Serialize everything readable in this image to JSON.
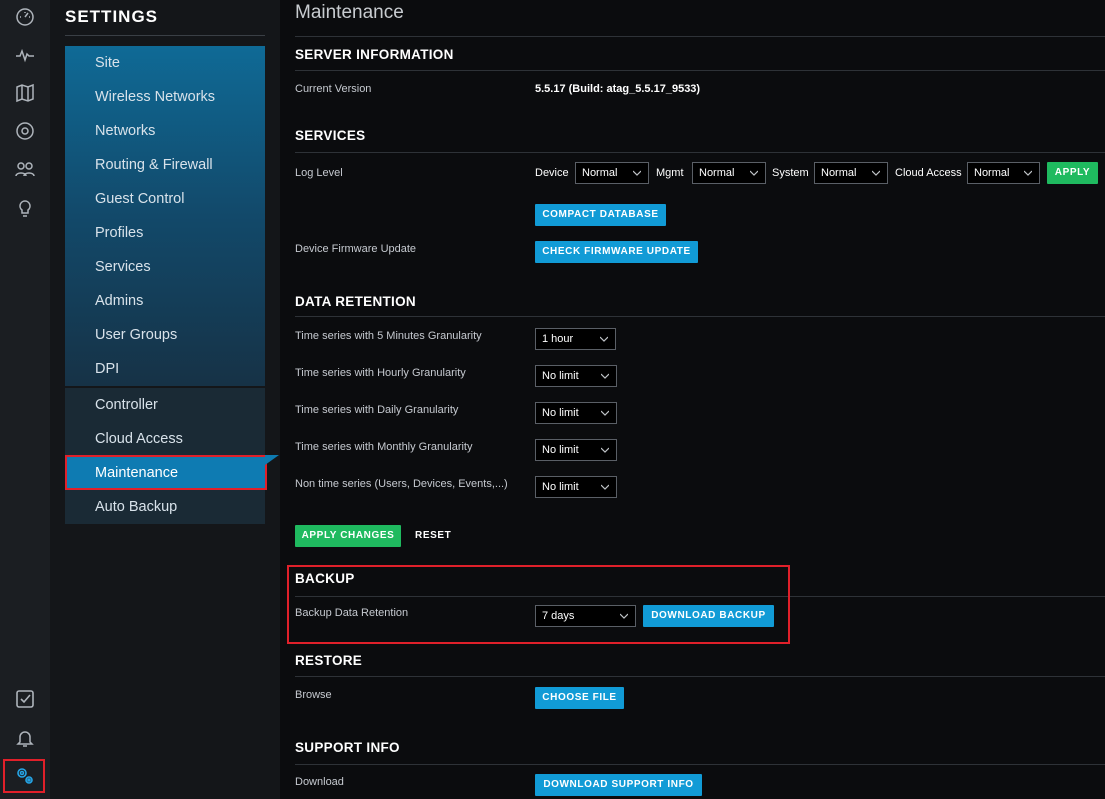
{
  "rail": {
    "icons": [
      "dashboard-icon",
      "statistics-icon",
      "map-icon",
      "devices-icon",
      "clients-icon",
      "insights-icon",
      "tasks-icon",
      "alerts-icon",
      "settings-icon"
    ]
  },
  "nav": {
    "title": "SETTINGS",
    "items": [
      {
        "label": "Site"
      },
      {
        "label": "Wireless Networks"
      },
      {
        "label": "Networks"
      },
      {
        "label": "Routing & Firewall"
      },
      {
        "label": "Guest Control"
      },
      {
        "label": "Profiles"
      },
      {
        "label": "Services"
      },
      {
        "label": "Admins"
      },
      {
        "label": "User Groups"
      },
      {
        "label": "DPI"
      },
      {
        "label": "Controller"
      },
      {
        "label": "Cloud Access"
      },
      {
        "label": "Maintenance"
      },
      {
        "label": "Auto Backup"
      }
    ],
    "active": "Maintenance"
  },
  "page": {
    "title": "Maintenance"
  },
  "server_info": {
    "title": "SERVER INFORMATION",
    "current_version_label": "Current Version",
    "current_version_value": "5.5.17 (Build: atag_5.5.17_9533)"
  },
  "services": {
    "title": "SERVICES",
    "log_level_label": "Log Level",
    "device_label": "Device",
    "device_value": "Normal",
    "mgmt_label": "Mgmt",
    "mgmt_value": "Normal",
    "system_label": "System",
    "system_value": "Normal",
    "cloud_access_label": "Cloud Access",
    "cloud_access_value": "Normal",
    "apply_label": "APPLY",
    "compact_db_label": "COMPACT DATABASE",
    "firmware_update_label": "Device Firmware Update",
    "check_firmware_label": "CHECK FIRMWARE UPDATE"
  },
  "data_retention": {
    "title": "DATA RETENTION",
    "rows": [
      {
        "label": "Time series with 5 Minutes Granularity",
        "value": "1 hour"
      },
      {
        "label": "Time series with Hourly Granularity",
        "value": "No limit"
      },
      {
        "label": "Time series with Daily Granularity",
        "value": "No limit"
      },
      {
        "label": "Time series with Monthly Granularity",
        "value": "No limit"
      },
      {
        "label": "Non time series (Users, Devices, Events,...)",
        "value": "No limit"
      }
    ],
    "apply_changes_label": "APPLY CHANGES",
    "reset_label": "RESET"
  },
  "backup": {
    "title": "BACKUP",
    "retention_label": "Backup Data Retention",
    "retention_value": "7 days",
    "download_label": "DOWNLOAD BACKUP"
  },
  "restore": {
    "title": "RESTORE",
    "browse_label": "Browse",
    "choose_file_label": "CHOOSE FILE"
  },
  "support": {
    "title": "SUPPORT INFO",
    "download_label": "Download",
    "download_button_label": "DOWNLOAD SUPPORT INFO"
  },
  "colors": {
    "accent_blue": "#119bd6",
    "accent_green": "#1fba5f",
    "highlight_red": "#e0202a",
    "active_nav": "#0e7bb2"
  }
}
